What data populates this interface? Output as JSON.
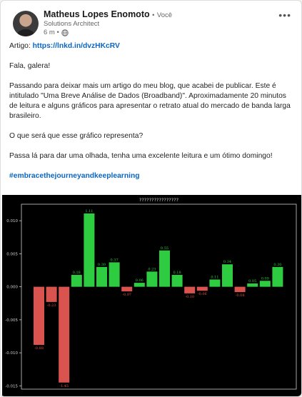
{
  "author": {
    "name": "Matheus Lopes Enomoto",
    "separator": "•",
    "badge": "Você",
    "headline": "Solutions Architect",
    "time": "6 m •",
    "visibility_icon": "globe-icon"
  },
  "post": {
    "link_label": "Artigo:",
    "link_url_text": "https://lnkd.in/dvzHKcRV",
    "greeting": "Fala, galera!",
    "paragraph1": "Passando para deixar mais um artigo do meu blog, que acabei de publicar. Este é intitulado \"Uma Breve Análise de Dados (Broadband)\". Aproximadamente 20 minutos de leitura e alguns gráficos para apresentar o retrato atual do mercado de banda larga brasileiro.",
    "question": "O que será que esse gráfico representa?",
    "closing": "Passa lá para dar uma olhada, tenha uma excelente leitura e um ótimo domingo!",
    "hashtag": "#embracethejourneyandkeeplearning"
  },
  "menu": {
    "more_icon": "ellipsis-icon",
    "more_label": "•••"
  },
  "colors": {
    "accent": "#0a66c2",
    "positive": "#2ecc40",
    "negative": "#d9534f"
  },
  "chart_data": {
    "type": "bar",
    "title": "????????????????",
    "ylim": [
      -0.0155,
      0.0125
    ],
    "yticks": [
      -0.015,
      -0.01,
      -0.005,
      0.0,
      0.005,
      0.01
    ],
    "ytick_labels": [
      "-0.015",
      "-0.010",
      "-0.005",
      "0.000",
      "0.005",
      "0.010"
    ],
    "values": [
      -0.0088,
      -0.0023,
      -0.0145,
      0.0018,
      0.0111,
      0.003,
      0.0037,
      -0.0007,
      0.0006,
      0.0023,
      0.0055,
      0.0018,
      -0.001,
      -0.0006,
      0.0011,
      0.0034,
      -0.0008,
      0.0005,
      0.0009,
      0.003
    ],
    "labels": [
      "-0.88",
      "-0.23",
      "-1.45",
      "0.18",
      "1.11",
      "0.30",
      "0.37",
      "-0.07",
      "0.06",
      "0.23",
      "0.55",
      "0.18",
      "-0.10",
      "-0.06",
      "0.11",
      "0.34",
      "-0.08",
      "0.05",
      "0.09",
      "0.30"
    ],
    "grid": false,
    "legend": "none"
  }
}
